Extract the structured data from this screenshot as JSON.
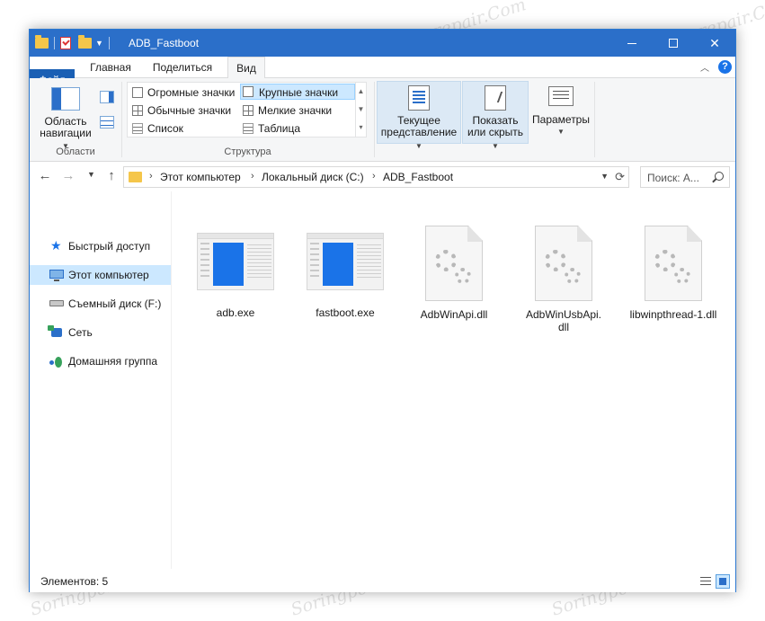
{
  "window": {
    "title": "ADB_Fastboot"
  },
  "ribbon_tabs": {
    "file": "Файл",
    "home": "Главная",
    "share": "Поделиться",
    "view": "Вид"
  },
  "ribbon": {
    "panes": {
      "nav_pane_line1": "Область",
      "nav_pane_line2": "навигации",
      "group": "Области"
    },
    "layout": {
      "items": [
        "Огромные значки",
        "Крупные значки",
        "Обычные значки",
        "Мелкие значки",
        "Список",
        "Таблица"
      ],
      "selected": "Крупные значки",
      "group": "Структура"
    },
    "current_view": {
      "line1": "Текущее",
      "line2": "представление"
    },
    "show_hide": {
      "line1": "Показать",
      "line2": "или скрыть"
    },
    "options": {
      "label": "Параметры"
    }
  },
  "address": {
    "crumbs": [
      "Этот компьютер",
      "Локальный диск (C:)",
      "ADB_Fastboot"
    ],
    "search_placeholder": "Поиск: A..."
  },
  "nav_pane": {
    "items": [
      "Быстрый доступ",
      "Этот компьютер",
      "Съемный диск (F:)",
      "Сеть",
      "Домашняя группа"
    ],
    "selected": "Этот компьютер"
  },
  "files": [
    {
      "name": "adb.exe",
      "type": "exe"
    },
    {
      "name": "fastboot.exe",
      "type": "exe"
    },
    {
      "name": "AdbWinApi.dll",
      "type": "dll"
    },
    {
      "name": "AdbWinUsbApi.dll",
      "type": "dll"
    },
    {
      "name": "libwinpthread-1.dll",
      "type": "dll"
    }
  ],
  "status": {
    "items_count": "Элементов: 5"
  },
  "watermark": "Soringpcrepair.Com",
  "colors": {
    "titlebar": "#2b6fc9",
    "file_tab": "#1a5fb4",
    "selection": "#cce8ff"
  }
}
